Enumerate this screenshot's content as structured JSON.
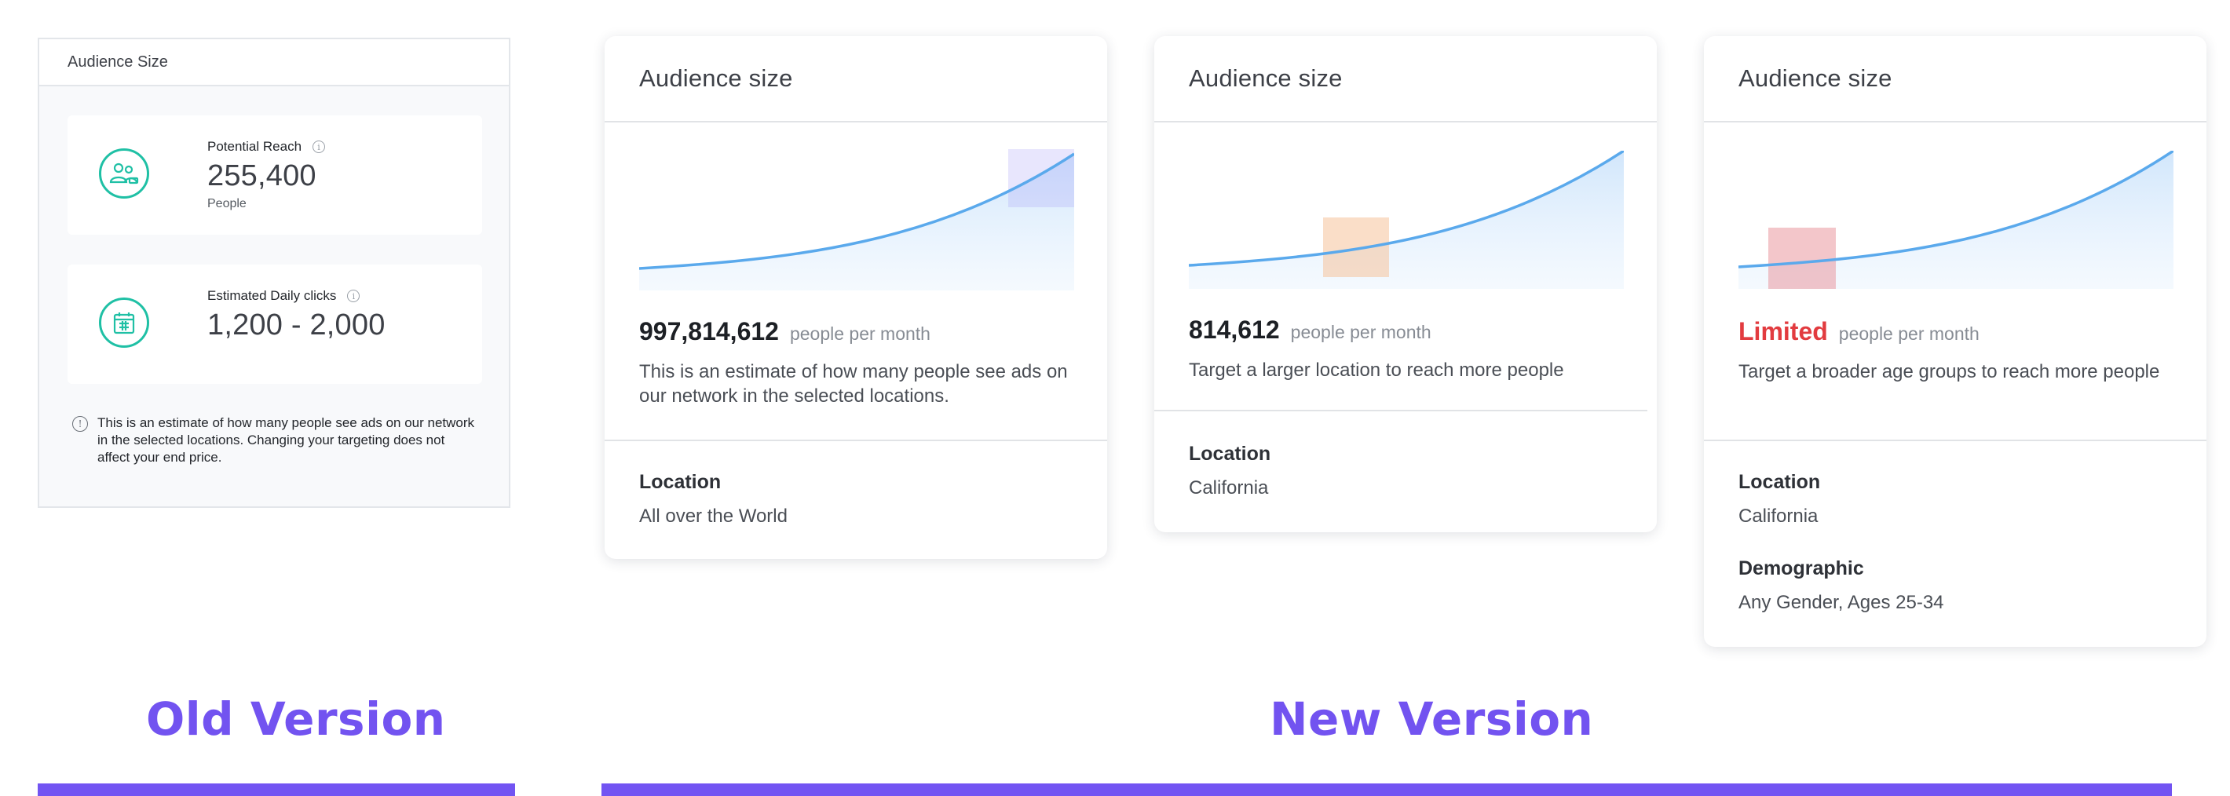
{
  "old_version": {
    "header_title": "Audience Size",
    "potential_reach": {
      "icon": "people-icon",
      "title": "Potential Reach",
      "value": "255,400",
      "unit": "People"
    },
    "daily_clicks": {
      "icon": "calendar-icon",
      "title": "Estimated Daily clicks",
      "value": "1,200 - 2,000"
    },
    "note": "This is an estimate of how many people see ads on our network in the selected locations. Changing your targeting does not affect your end price.",
    "label": "Old Version"
  },
  "new_version": {
    "label": "New Version",
    "cards": [
      {
        "header_title": "Audience size",
        "figure": "997,814,612",
        "per_month": "people per month",
        "description": "This is an estimate of how many people see ads on our network in the selected locations.",
        "location_label": "Location",
        "location_value": "All over the World",
        "highlight_color": "#a59cf7"
      },
      {
        "header_title": "Audience size",
        "figure": "814,612",
        "per_month": "people per month",
        "description": "Target a larger location to reach more people",
        "location_label": "Location",
        "location_value": "California",
        "highlight_color": "#f6c39a"
      },
      {
        "header_title": "Audience size",
        "figure": "Limited",
        "per_month": "people per month",
        "description": "Target a broader age groups to reach more people",
        "location_label": "Location",
        "location_value": "California",
        "demographic_label": "Demographic",
        "demographic_value": "Any Gender, Ages 25-34",
        "highlight_color": "#e78d96"
      }
    ]
  },
  "colors": {
    "accent_purple": "#7253f0",
    "teal": "#1fc0a5",
    "curve_blue": "#5aa9ec",
    "limited_red": "#e23b3f"
  }
}
